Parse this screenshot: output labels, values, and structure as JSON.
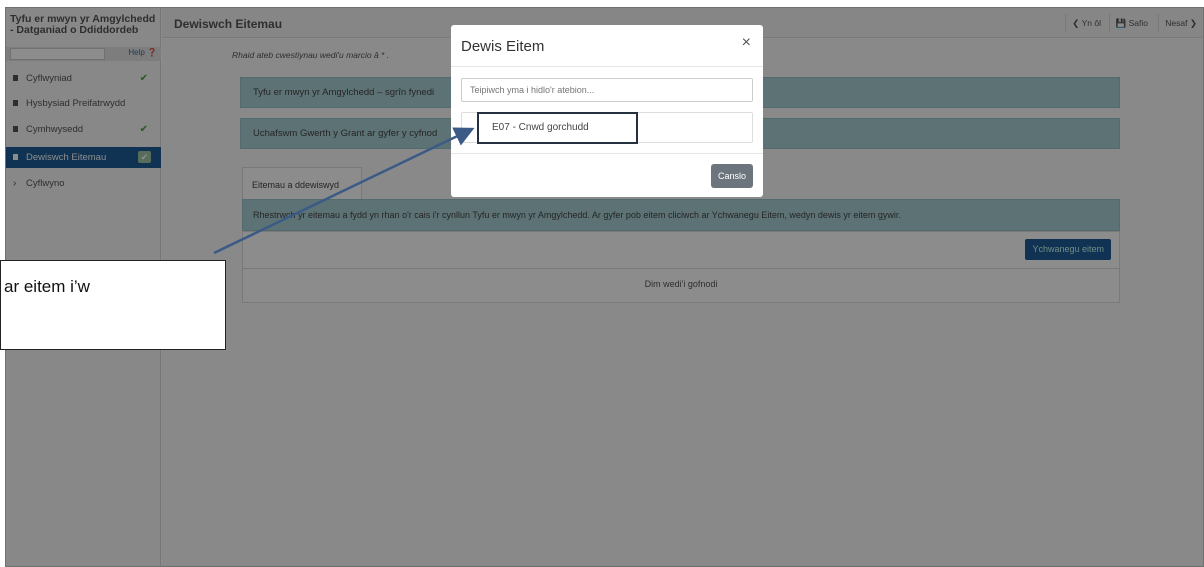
{
  "sidebar": {
    "app_title": "Tyfu er mwyn yr Amgylchedd - Datganiad o Ddiddordeb",
    "help_label": "Help",
    "help_icon": "question-circle-icon",
    "items": [
      {
        "label": "Cyflwyniad",
        "complete": true
      },
      {
        "label": "Hysbysiad Preifatrwydd",
        "complete": false
      },
      {
        "label": "Cymhwysedd",
        "complete": true
      },
      {
        "label": "Dewiswch Eitemau",
        "complete": true,
        "active": true
      },
      {
        "label": "Cyflwyno",
        "complete": false
      }
    ]
  },
  "header": {
    "title": "Dewiswch Eitemau",
    "back_label": "Yn ôl",
    "save_label": "Safio",
    "next_label": "Nesaf"
  },
  "main": {
    "required_note": "Rhaid ateb cwestiynau wedi'u marcio â * .",
    "bar1": "Tyfu er mwyn yr Amgylchedd – sgrîn fynedi",
    "bar2": "Uchafswm Gwerth y Grant ar gyfer y cyfnod",
    "tab_label": "Eitemau a ddewiswyd",
    "info_text": "Rhestrwch yr eitemau a fydd yn rhan o'r cais i'r cynllun Tyfu er mwyn yr Amgylchedd. Ar gyfer pob eitem cliciwch ar Ychwanegu Eitem, wedyn dewis yr eitem gywir.",
    "add_button": "Ychwanegu eitem",
    "empty_text": "Dim wedi'i gofnodi"
  },
  "modal": {
    "title": "Dewis Eitem",
    "close": "×",
    "filter_placeholder": "Teipiwch yma i hidlo'r atebion...",
    "option": "E07 - Cnwd gorchudd",
    "cancel_label": "Canslo"
  },
  "callout": {
    "text": "ar eitem i’w"
  },
  "colors": {
    "accent": "#1e5c97",
    "info_bar": "#a9cfd6",
    "check": "#4a9d45",
    "cancel": "#6c757d"
  }
}
